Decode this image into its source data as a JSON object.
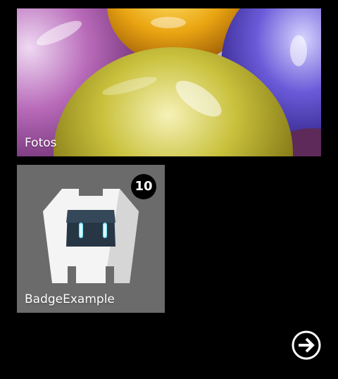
{
  "tiles": {
    "photos": {
      "label": "Fotos"
    },
    "app": {
      "label": "BadgeExample",
      "badge_count": "10",
      "background": "#6b6b6b"
    }
  },
  "navigation": {
    "next_icon": "arrow-right-circle-icon"
  },
  "colors": {
    "background": "#000000",
    "foreground": "#ffffff"
  }
}
